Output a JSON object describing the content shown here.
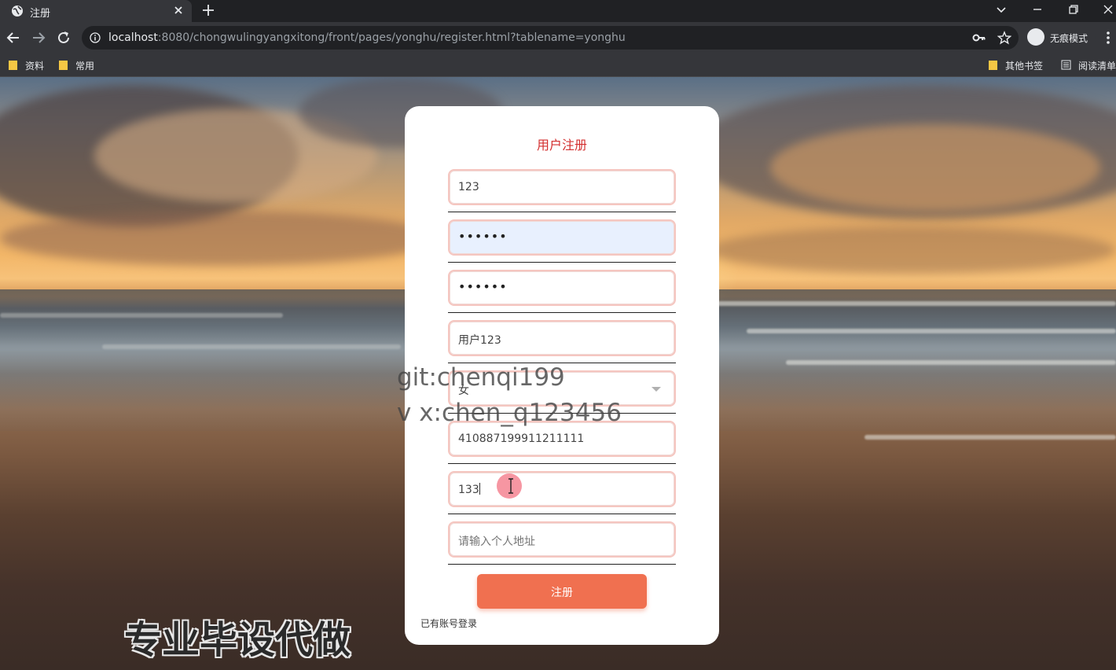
{
  "browser": {
    "tab_title": "注册",
    "url_host": "localhost",
    "url_rest": ":8080/chongwulingyangxitong/front/pages/yonghu/register.html?tablename=yonghu",
    "incognito_label": "无痕模式",
    "bookmarks": [
      "资料",
      "常用"
    ],
    "bookmarks_right": [
      "其他书签",
      "阅读清单"
    ]
  },
  "form": {
    "title": "用户注册",
    "fields": [
      {
        "value": "123"
      },
      {
        "value": "••••••"
      },
      {
        "value": "••••••"
      },
      {
        "value": "用户123"
      },
      {
        "value": "女"
      },
      {
        "value": "410887199911211111"
      },
      {
        "value": "133"
      },
      {
        "placeholder": "请输入个人地址"
      }
    ],
    "submit_label": "注册",
    "login_link": "已有账号登录"
  },
  "overlays": {
    "watermark_line1": "git:chenqi199",
    "watermark_line2": "v x:chen_q123456",
    "banner": "专业毕设代做"
  },
  "colors": {
    "title": "#d32f2f",
    "button": "#f07050",
    "field_border": "#f5c6c0",
    "autofill_bg": "#e8f0fe"
  }
}
